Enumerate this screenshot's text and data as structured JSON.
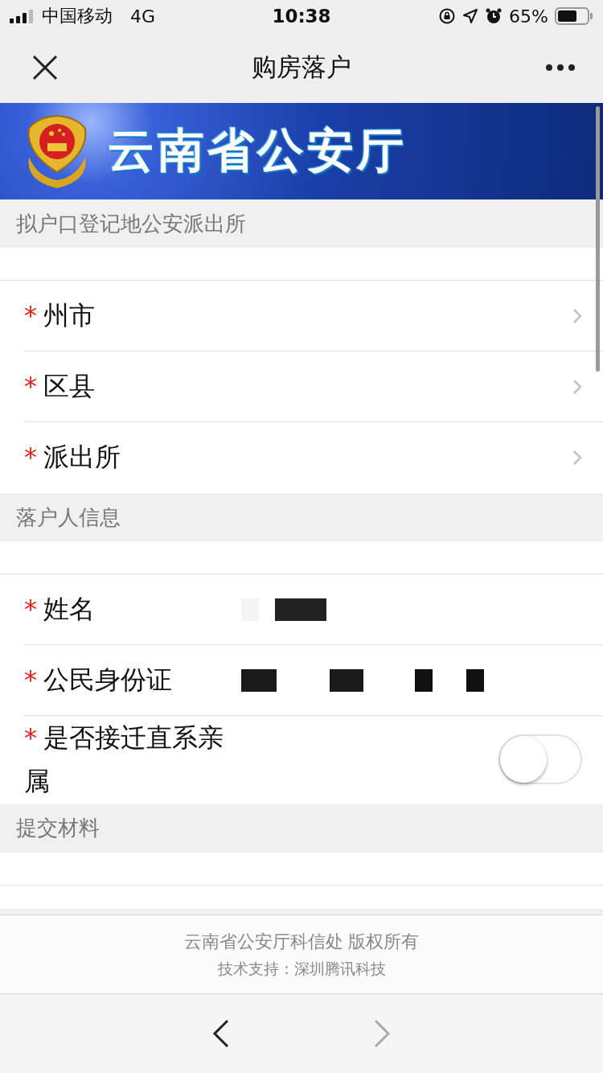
{
  "status_bar": {
    "carrier": "中国移动",
    "network": "4G",
    "time": "10:38",
    "battery": "65%"
  },
  "nav": {
    "title": "购房落户"
  },
  "banner": {
    "title": "云南省公安厅"
  },
  "sections": [
    {
      "title": "拟户口登记地公安派出所",
      "rows": [
        {
          "kind": "select",
          "label": "州市",
          "required": "*"
        },
        {
          "kind": "select",
          "label": "区县",
          "required": "*"
        },
        {
          "kind": "select",
          "label": "派出所",
          "required": "*"
        }
      ]
    },
    {
      "title": "落户人信息",
      "rows": [
        {
          "kind": "text",
          "label": "姓名",
          "required": "*",
          "redacted": true
        },
        {
          "kind": "text",
          "label": "公民身份证",
          "required": "*",
          "redacted": true
        },
        {
          "kind": "toggle",
          "label": "是否接迁直系亲属",
          "required": "*",
          "on": false
        }
      ]
    },
    {
      "title": "提交材料"
    }
  ],
  "footer": {
    "copyright": "云南省公安厅科信处 版权所有",
    "support": "技术支持：深圳腾讯科技"
  },
  "toolbar": {
    "back_disabled": false,
    "forward_disabled": true
  }
}
